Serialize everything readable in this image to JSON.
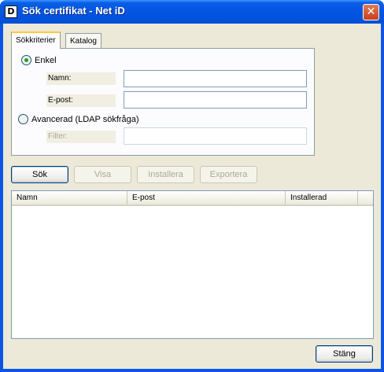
{
  "window": {
    "title": "Sök certifikat - Net iD",
    "icon_letter": "D",
    "close_glyph": "✕"
  },
  "tabs": [
    {
      "label": "Sökkriterier",
      "active": true
    },
    {
      "label": "Katalog",
      "active": false
    }
  ],
  "search": {
    "simple": {
      "label": "Enkel",
      "checked": true
    },
    "name_label": "Namn:",
    "name_value": "",
    "email_label": "E-post:",
    "email_value": "",
    "advanced": {
      "label": "Avancerad (LDAP sökfråga)",
      "checked": false
    },
    "filter_label": "Filter:",
    "filter_value": ""
  },
  "actions": {
    "search": "Sök",
    "view": "Visa",
    "install": "Installera",
    "export": "Exportera"
  },
  "results": {
    "columns": [
      "Namn",
      "E-post",
      "Installerad"
    ],
    "rows": []
  },
  "footer": {
    "close": "Stäng"
  },
  "colors": {
    "titlebar": "#0a55e6",
    "dialog_bg": "#ece9d8",
    "radio_dot": "#21a121",
    "tab_highlight": "#ffc83c"
  }
}
